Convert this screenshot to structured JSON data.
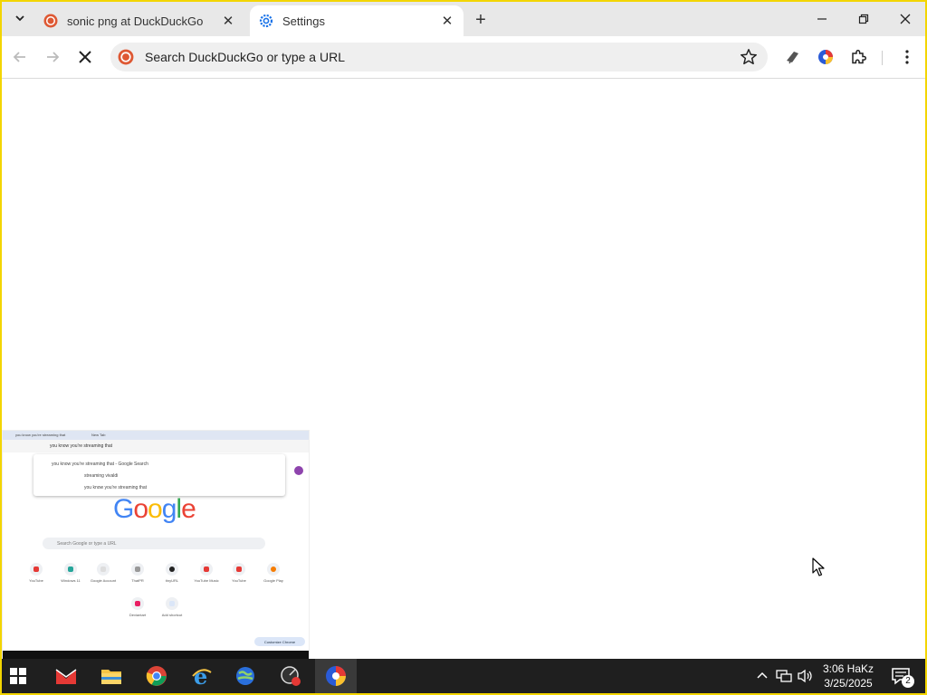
{
  "browser": {
    "tabs": [
      {
        "title": "sonic png at DuckDuckGo",
        "active": false
      },
      {
        "title": "Settings",
        "active": true
      }
    ],
    "omnibox": {
      "placeholder": "Search DuckDuckGo or type a URL",
      "value": ""
    }
  },
  "thumbnail": {
    "tab_labels": [
      "you know you're streaming that",
      "New Tab"
    ],
    "omnibox_text": "you know you're streaming that",
    "suggestions": [
      "you know you're streaming that - Google Search",
      "streaming vivaldi",
      "you know you're streaming that"
    ],
    "logo_text": "Google",
    "search_placeholder": "Search Google or type a URL",
    "shortcuts": [
      "YouTube",
      "Windows 11",
      "Google Account",
      "ThatPR",
      "tinyURL",
      "YouTube Music",
      "YouTube",
      "Google Play",
      "Deviantart",
      "Add shortcut"
    ],
    "customize_label": "Customize Chrome"
  },
  "taskbar": {
    "time": "3:06 HaKz",
    "date": "3/25/2025",
    "notification_count": "2"
  },
  "colors": {
    "frame_border": "#f3d500",
    "tabstrip": "#e8e8e8",
    "omnibox": "#efefef",
    "taskbar": "#1f1f1f",
    "ddg_orange": "#de5833",
    "chrome_settings_blue": "#1a73e8"
  }
}
